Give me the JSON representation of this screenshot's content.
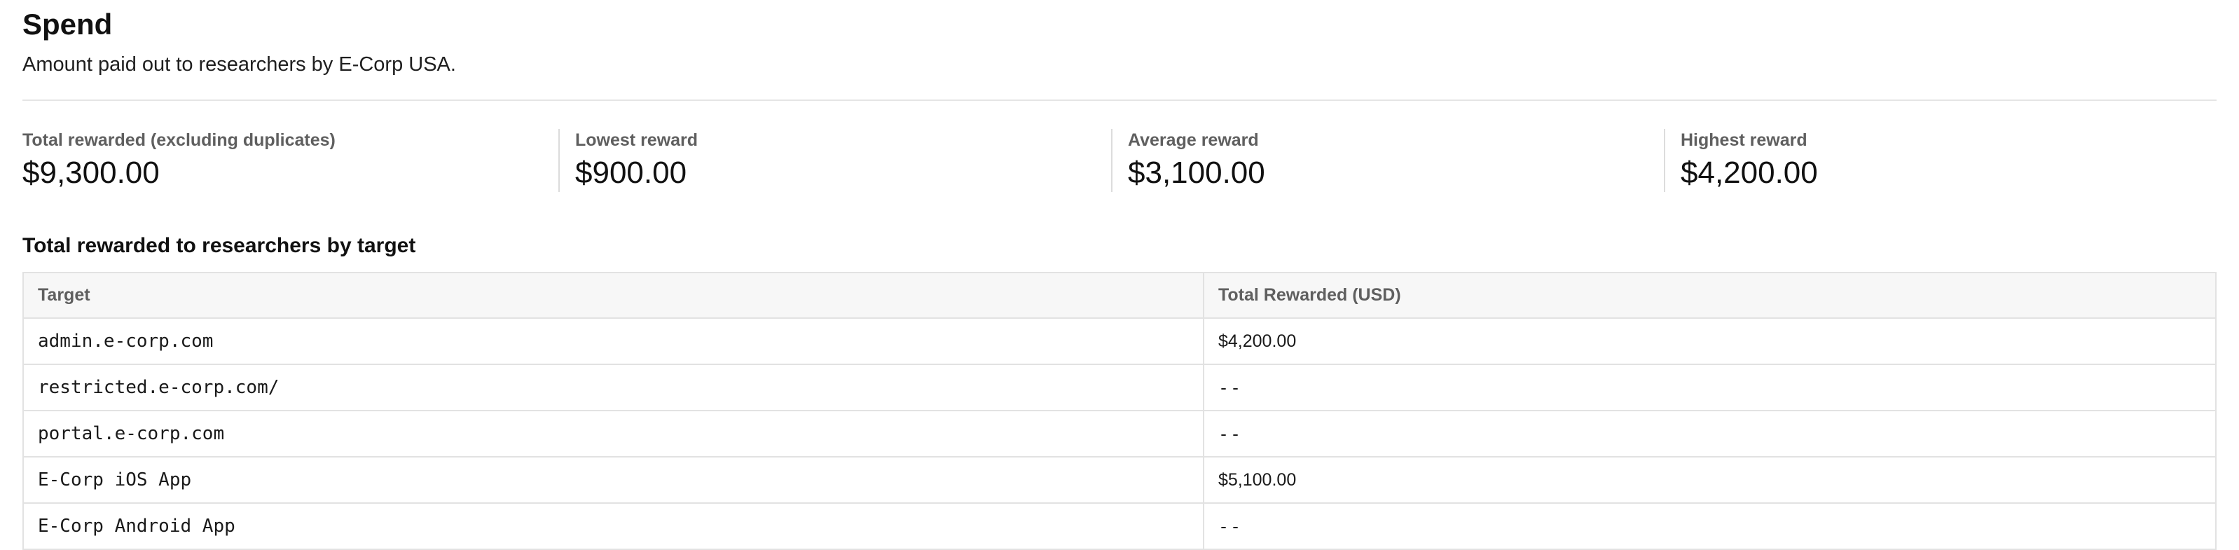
{
  "header": {
    "title": "Spend",
    "subtitle": "Amount paid out to researchers by E-Corp USA."
  },
  "stats": [
    {
      "label": "Total rewarded (excluding duplicates)",
      "value": "$9,300.00"
    },
    {
      "label": "Lowest reward",
      "value": "$900.00"
    },
    {
      "label": "Average reward",
      "value": "$3,100.00"
    },
    {
      "label": "Highest reward",
      "value": "$4,200.00"
    }
  ],
  "section": {
    "title": "Total rewarded to researchers by target"
  },
  "table": {
    "columns": [
      "Target",
      "Total Rewarded (USD)"
    ],
    "rows": [
      {
        "target": "admin.e-corp.com",
        "total": "$4,200.00"
      },
      {
        "target": "restricted.e-corp.com/",
        "total": "--"
      },
      {
        "target": "portal.e-corp.com",
        "total": "--"
      },
      {
        "target": "E-Corp iOS App",
        "total": "$5,100.00"
      },
      {
        "target": "E-Corp Android App",
        "total": "--"
      }
    ]
  }
}
